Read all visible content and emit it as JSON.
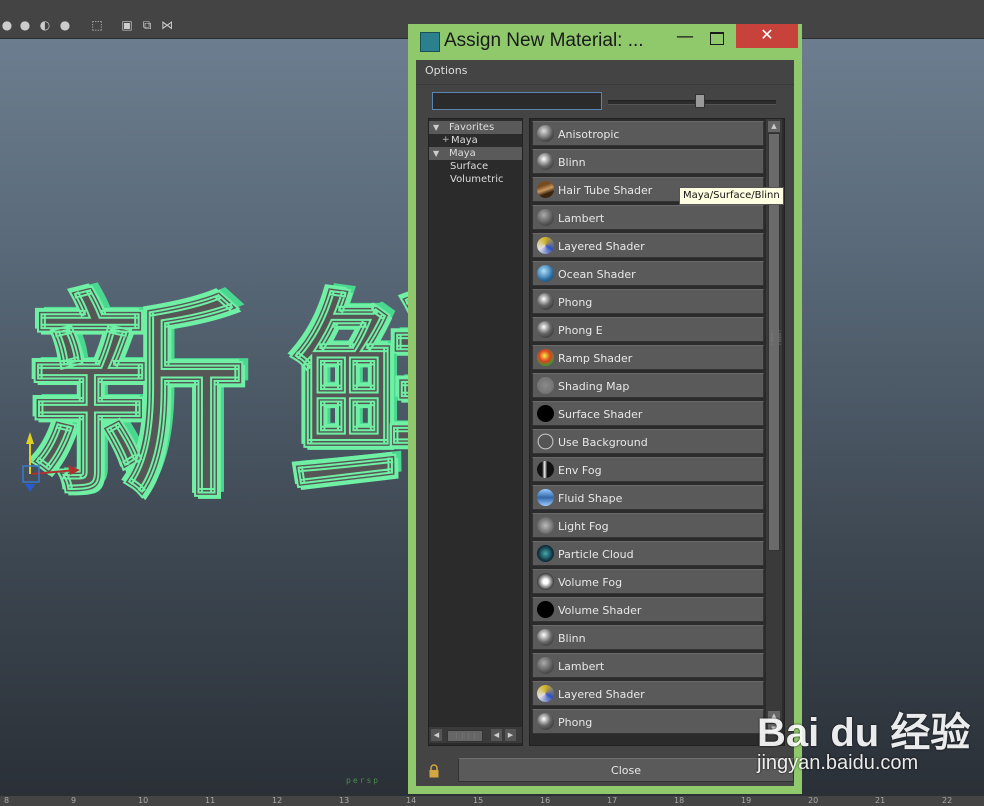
{
  "dialog": {
    "title": "Assign New Material: ...",
    "menu": {
      "options_label": "Options"
    },
    "search": {
      "value": ""
    },
    "tree": [
      {
        "label": "Favorites",
        "expanded": true,
        "selected": true
      },
      {
        "label": "Maya",
        "prefix": "+"
      },
      {
        "label": "Maya",
        "expanded": true,
        "selected": true
      },
      {
        "label": "Surface"
      },
      {
        "label": "Volumetric"
      }
    ],
    "materials": [
      {
        "label": "Anisotropic",
        "icon": "anisotropic-icon"
      },
      {
        "label": "Blinn",
        "icon": "blinn-icon"
      },
      {
        "label": "Hair Tube Shader",
        "icon": "hair-tube-shader-icon"
      },
      {
        "label": "Lambert",
        "icon": "lambert-icon"
      },
      {
        "label": "Layered Shader",
        "icon": "layered-shader-icon"
      },
      {
        "label": "Ocean Shader",
        "icon": "ocean-shader-icon"
      },
      {
        "label": "Phong",
        "icon": "phong-icon"
      },
      {
        "label": "Phong E",
        "icon": "phong-e-icon"
      },
      {
        "label": "Ramp Shader",
        "icon": "ramp-shader-icon"
      },
      {
        "label": "Shading Map",
        "icon": "shading-map-icon"
      },
      {
        "label": "Surface Shader",
        "icon": "surface-shader-icon"
      },
      {
        "label": "Use Background",
        "icon": "use-background-icon"
      },
      {
        "label": "Env Fog",
        "icon": "env-fog-icon"
      },
      {
        "label": "Fluid Shape",
        "icon": "fluid-shape-icon"
      },
      {
        "label": "Light Fog",
        "icon": "light-fog-icon"
      },
      {
        "label": "Particle Cloud",
        "icon": "particle-cloud-icon"
      },
      {
        "label": "Volume Fog",
        "icon": "volume-fog-icon"
      },
      {
        "label": "Volume Shader",
        "icon": "volume-shader-icon"
      },
      {
        "label": "Blinn",
        "icon": "blinn-icon"
      },
      {
        "label": "Lambert",
        "icon": "lambert-icon"
      },
      {
        "label": "Layered Shader",
        "icon": "layered-shader-icon"
      },
      {
        "label": "Phong",
        "icon": "phong-icon"
      }
    ],
    "tooltip": "Maya/Surface/Blinn",
    "close_label": "Close",
    "accent_color": "#8fc96c",
    "close_x_color": "#c7423b"
  },
  "viewport": {
    "scene_text": "新鲜",
    "camera_label": "persp",
    "ruler_ticks": [
      "8",
      "9",
      "10",
      "11",
      "12",
      "13",
      "14",
      "15",
      "16",
      "17",
      "18",
      "19",
      "20",
      "21",
      "22"
    ],
    "text_outline_color": "#6ff0a4"
  },
  "watermark": {
    "logo": "Bai du 经验",
    "url": "jingyan.baidu.com"
  }
}
